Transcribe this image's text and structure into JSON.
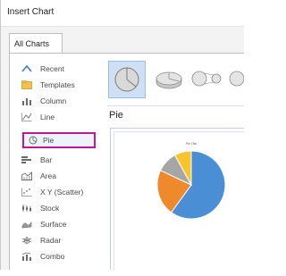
{
  "window": {
    "title": "Insert Chart"
  },
  "tabs": [
    {
      "label": "All Charts"
    }
  ],
  "sidebar": {
    "items": [
      {
        "label": "Recent",
        "icon": "recent-icon"
      },
      {
        "label": "Templates",
        "icon": "templates-icon"
      },
      {
        "label": "Column",
        "icon": "column-chart-icon"
      },
      {
        "label": "Line",
        "icon": "line-chart-icon"
      },
      {
        "label": "Pie",
        "icon": "pie-chart-icon",
        "selected": true
      },
      {
        "label": "Bar",
        "icon": "bar-chart-icon"
      },
      {
        "label": "Area",
        "icon": "area-chart-icon"
      },
      {
        "label": "X Y (Scatter)",
        "icon": "scatter-chart-icon"
      },
      {
        "label": "Stock",
        "icon": "stock-chart-icon"
      },
      {
        "label": "Surface",
        "icon": "surface-chart-icon"
      },
      {
        "label": "Radar",
        "icon": "radar-chart-icon"
      },
      {
        "label": "Combo",
        "icon": "combo-chart-icon"
      }
    ]
  },
  "subtypes": [
    {
      "icon": "pie-subtype-icon",
      "selected": true
    },
    {
      "icon": "3d-pie-subtype-icon"
    },
    {
      "icon": "pie-of-pie-subtype-icon"
    },
    {
      "icon": "bar-of-pie-subtype-icon"
    }
  ],
  "main": {
    "chart_title": "Pie",
    "preview_caption": "Pie Title"
  },
  "preview_pie": {
    "slices": [
      {
        "fraction": 0.6,
        "color": "#4a8fd6"
      },
      {
        "fraction": 0.22,
        "color": "#ef8a2c"
      },
      {
        "fraction": 0.1,
        "color": "#a6a6a6"
      },
      {
        "fraction": 0.08,
        "color": "#f7c52b"
      }
    ]
  },
  "colors": {
    "selection_border": "#c2188f",
    "selected_subtype_bg": "#cfe0f4",
    "accent_blue": "#4a8fd6"
  }
}
